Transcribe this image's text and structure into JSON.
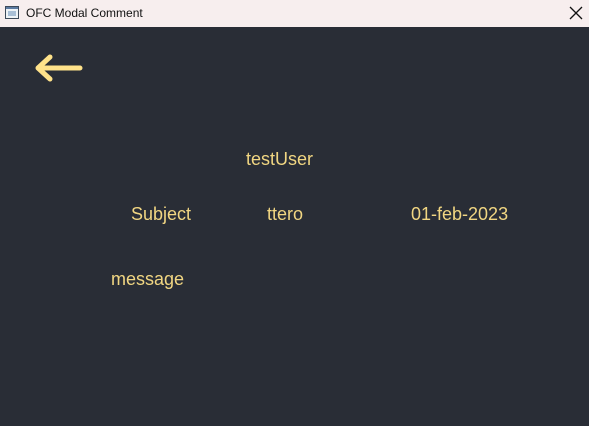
{
  "window": {
    "title": "OFC Modal Comment",
    "icon": "app-window-icon",
    "close_icon": "close-icon"
  },
  "header": {
    "back_icon": "arrow-left-icon"
  },
  "comment": {
    "user": "testUser",
    "subject_label": "Subject",
    "subject_value": "ttero",
    "date": "01-feb-2023",
    "message": "message"
  },
  "colors": {
    "background": "#292d36",
    "titlebar": "#f7eeee",
    "accent_text": "#f1d682",
    "back_arrow": "#ffe28a"
  }
}
